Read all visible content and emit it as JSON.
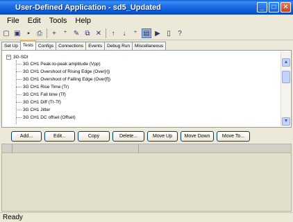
{
  "window": {
    "title": "User-Defined Application - sd5_Updated",
    "controls": [
      "minimize",
      "maximize",
      "close"
    ]
  },
  "menu": [
    "File",
    "Edit",
    "Tools",
    "Help"
  ],
  "toolbar_icons": [
    "new-icon",
    "open-icon",
    "save-icon",
    "print-icon",
    "add-icon",
    "add-child-icon",
    "edit-icon",
    "copy-icon",
    "delete-icon",
    "move-up-icon",
    "move-down-icon",
    "add-step-icon",
    "view-icon",
    "run-icon",
    "stop-icon",
    "help-icon"
  ],
  "tabs": [
    {
      "label": "Set Up",
      "selected": false
    },
    {
      "label": "Tests",
      "selected": true
    },
    {
      "label": "Configs",
      "selected": false
    },
    {
      "label": "Connections",
      "selected": false
    },
    {
      "label": "Events",
      "selected": false
    },
    {
      "label": "Debug Run",
      "selected": false
    },
    {
      "label": "Miscellaneous",
      "selected": false
    }
  ],
  "tree": {
    "root": "3G-SDI",
    "expander": "−",
    "items": [
      "3G CH1 Peak-to-peak amplitude (Vpp)",
      "3G CH1 Overshoot of Rising Edge (Over[r])",
      "3G CH1 Overshoot of Falling Edge (Over[f])",
      "3G CH1 Rise Time (Tr)",
      "3G CH1 Fall time (Tf)",
      "3G CH1 Diff (Tr-Tf)",
      "3G CH1 Jitter",
      "3G CH1 DC offset (Offset)"
    ]
  },
  "buttons": [
    "Add...",
    "Edit...",
    "Copy",
    "Delete...",
    "Move Up",
    "Move Down",
    "Move To..."
  ],
  "status": "Ready"
}
